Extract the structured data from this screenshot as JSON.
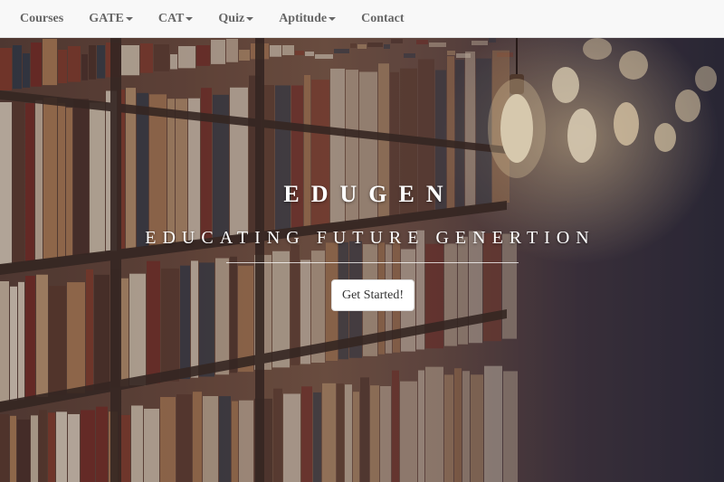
{
  "nav": {
    "items": [
      {
        "label": "Courses",
        "dropdown": false
      },
      {
        "label": "GATE",
        "dropdown": true
      },
      {
        "label": "CAT",
        "dropdown": true
      },
      {
        "label": "Quiz",
        "dropdown": true
      },
      {
        "label": "Aptitude",
        "dropdown": true
      },
      {
        "label": "Contact",
        "dropdown": false
      }
    ]
  },
  "hero": {
    "title": "EDUGEN",
    "subtitle": "EDUCATING FUTURE GENERTION",
    "cta_label": "Get Started!",
    "background": "library-bookshelves-photo"
  },
  "colors": {
    "navbar_bg": "#f8f8f8",
    "nav_text": "#666666",
    "hero_text": "#ffffff",
    "button_bg": "#ffffff"
  }
}
